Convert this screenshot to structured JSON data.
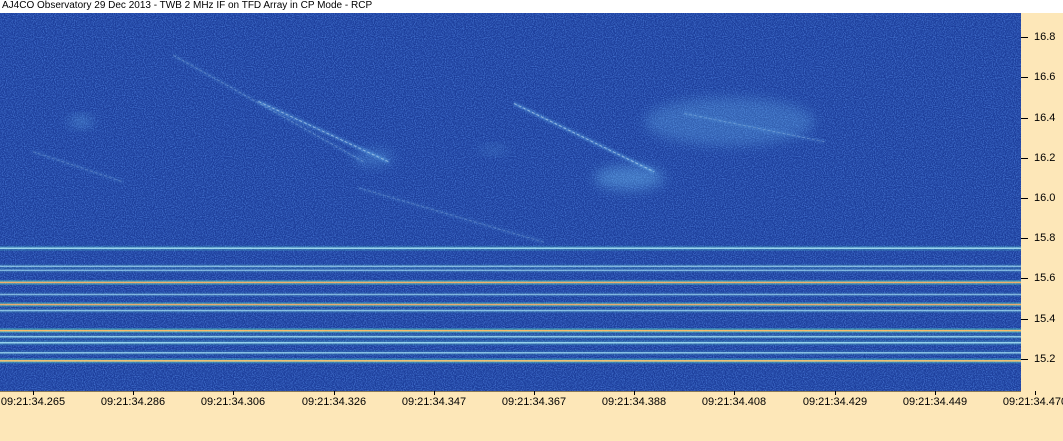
{
  "title": "AJ4CO Observatory 29 Dec 2013 - TWB 2 MHz IF on TFD Array in CP Mode - RCP",
  "colors": {
    "background": "#1a3a9a",
    "noise_light": "#3a6ee0",
    "noise_dark": "#0a1f6a",
    "burst": "#7fd6ff",
    "band_core": "#f6f08a",
    "band_hot": "#ff5a3a",
    "band_edge": "#5ff0c8",
    "axis_bg": "#fde7b8"
  },
  "chart_data": {
    "type": "heatmap",
    "title": "AJ4CO Observatory 29 Dec 2013 - TWB 2 MHz IF on TFD Array in CP Mode - RCP",
    "xlabel": "",
    "ylabel": "",
    "x_ticks": [
      "09:21:34.265",
      "09:21:34.286",
      "09:21:34.306",
      "09:21:34.326",
      "09:21:34.347",
      "09:21:34.367",
      "09:21:34.388",
      "09:21:34.408",
      "09:21:34.429",
      "09:21:34.449",
      "09:21:34.470"
    ],
    "x_tick_index": [
      0,
      1,
      2,
      3,
      4,
      5,
      6,
      7,
      8,
      9,
      10
    ],
    "xlim": [
      0,
      10.2
    ],
    "y_ticks": [
      "16.8",
      "16.6",
      "16.4",
      "16.2",
      "16.0",
      "15.8",
      "15.6",
      "15.4",
      "15.2"
    ],
    "y_tick_values": [
      16.8,
      16.6,
      16.4,
      16.2,
      16.0,
      15.8,
      15.6,
      15.4,
      15.2
    ],
    "ylim": [
      15.04,
      16.92
    ],
    "interference_bands": [
      {
        "freq": 15.75,
        "strength": 0.55
      },
      {
        "freq": 15.66,
        "strength": 0.25
      },
      {
        "freq": 15.64,
        "strength": 0.2
      },
      {
        "freq": 15.58,
        "strength": 0.85
      },
      {
        "freq": 15.52,
        "strength": 0.2
      },
      {
        "freq": 15.47,
        "strength": 0.75
      },
      {
        "freq": 15.44,
        "strength": 0.3
      },
      {
        "freq": 15.34,
        "strength": 1.0
      },
      {
        "freq": 15.31,
        "strength": 0.4
      },
      {
        "freq": 15.28,
        "strength": 0.5
      },
      {
        "freq": 15.23,
        "strength": 0.3
      },
      {
        "freq": 15.19,
        "strength": 0.95
      }
    ],
    "bursts": [
      {
        "x0": 1.4,
        "f0": 16.71,
        "x1": 3.3,
        "f1": 16.18,
        "strength": 0.35
      },
      {
        "x0": 2.25,
        "f0": 16.48,
        "x1": 3.55,
        "f1": 16.18,
        "strength": 0.8
      },
      {
        "x0": 3.25,
        "f0": 16.05,
        "x1": 5.1,
        "f1": 15.78,
        "strength": 0.3
      },
      {
        "x0": 0.0,
        "f0": 16.23,
        "x1": 0.9,
        "f1": 16.08,
        "strength": 0.3
      },
      {
        "x0": 4.8,
        "f0": 16.47,
        "x1": 6.2,
        "f1": 16.13,
        "strength": 0.85
      },
      {
        "x0": 6.5,
        "f0": 16.42,
        "x1": 7.9,
        "f1": 16.28,
        "strength": 0.35
      }
    ],
    "blobs": [
      {
        "x": 0.48,
        "f": 16.38,
        "rx": 0.12,
        "rf": 0.025,
        "strength": 0.8
      },
      {
        "x": 3.4,
        "f": 16.2,
        "rx": 0.2,
        "rf": 0.04,
        "strength": 0.5
      },
      {
        "x": 4.6,
        "f": 16.24,
        "rx": 0.15,
        "rf": 0.02,
        "strength": 0.45
      },
      {
        "x": 5.95,
        "f": 16.1,
        "rx": 0.35,
        "rf": 0.06,
        "strength": 0.75
      },
      {
        "x": 6.95,
        "f": 16.38,
        "rx": 0.85,
        "rf": 0.12,
        "strength": 0.5
      }
    ]
  }
}
